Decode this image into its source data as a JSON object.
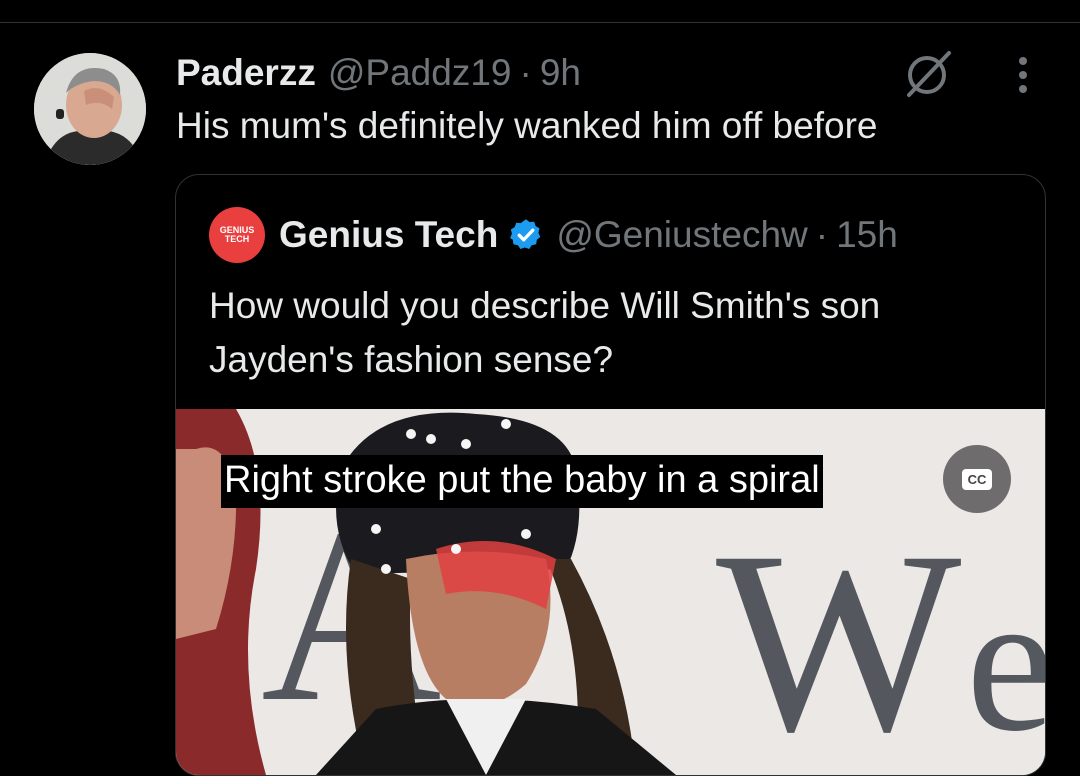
{
  "tweet": {
    "author_name": "Paderzz",
    "handle": "@Paddz19",
    "separator": "·",
    "time": "9h",
    "text": "His mum's definitely wanked him off before"
  },
  "quoted_tweet": {
    "logo_text_line1": "GENIUS",
    "logo_text_line2": "TECH",
    "author_name": "Genius Tech",
    "handle": "@Geniustechw",
    "separator": "·",
    "time": "15h",
    "text": "How would you describe Will Smith's son Jayden's fashion sense?",
    "verified_color": "#1d9bf0"
  },
  "video": {
    "caption": "Right stroke put the baby in a spiral",
    "cc_label": "CC"
  },
  "icons": [
    "grok-icon",
    "more-icon",
    "verified-badge-icon",
    "closed-captions-icon"
  ]
}
